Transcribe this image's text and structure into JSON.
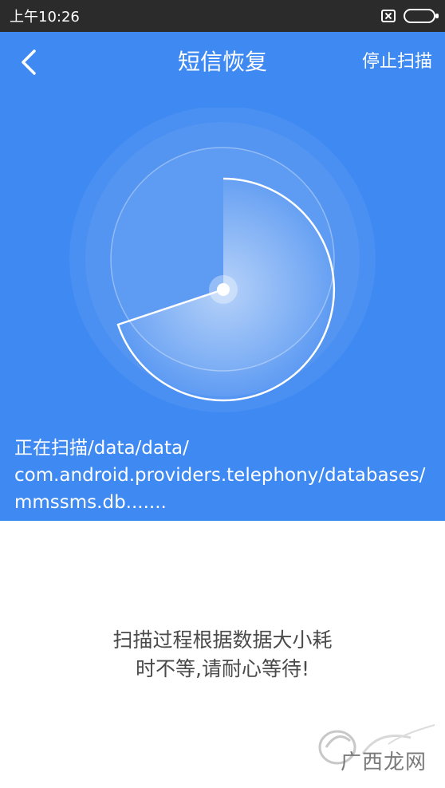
{
  "status_bar": {
    "time": "上午10:26",
    "icons": [
      "sim-off-icon",
      "battery-icon"
    ]
  },
  "header": {
    "title": "短信恢复",
    "action_label": "停止扫描",
    "back_icon": "chevron-left-icon"
  },
  "scan": {
    "line1": "正在扫描/data/data/",
    "line2": "com.android.providers.telephony/databases/",
    "line3": "mmssms.db......."
  },
  "hint": {
    "line1": "扫描过程根据数据大小耗",
    "line2": "时不等,请耐心等待!"
  },
  "watermark": {
    "brand": "广西龙网"
  },
  "colors": {
    "primary": "#3f89f2",
    "status_bar": "#2b2b2b",
    "text_dark": "#4a4a4a"
  }
}
